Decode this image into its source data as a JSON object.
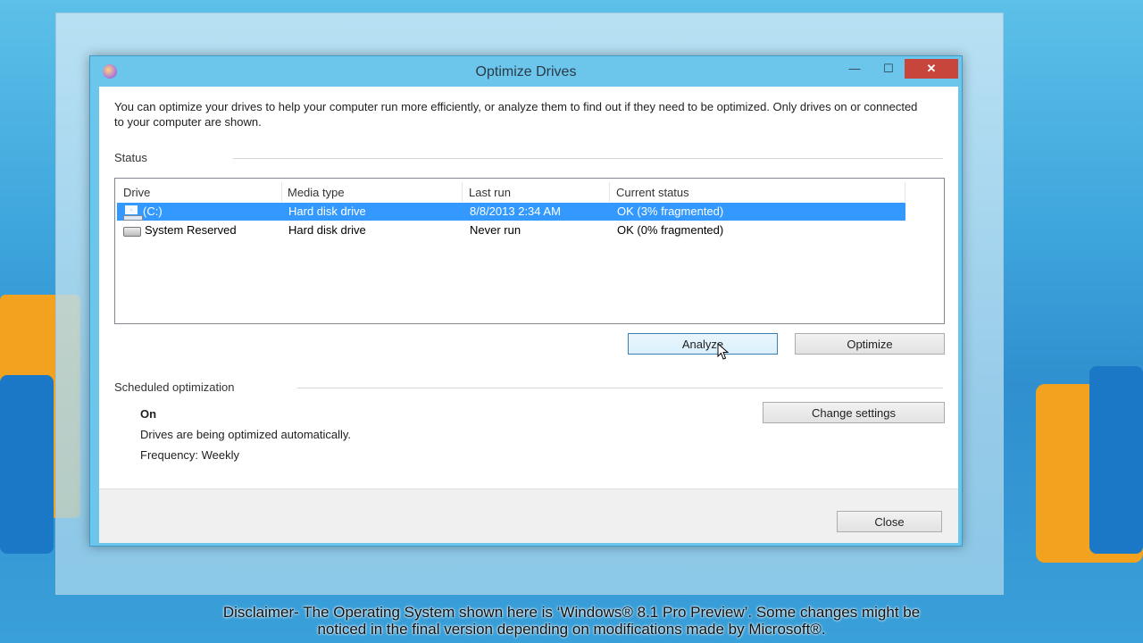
{
  "window": {
    "title": "Optimize Drives",
    "minimize_label": "—",
    "maximize_label": "☐",
    "close_label": "✕"
  },
  "description": "You can optimize your drives to help your computer run more efficiently, or analyze them to find out if they need to be optimized. Only drives on or connected to your computer are shown.",
  "status": {
    "label": "Status",
    "columns": [
      "Drive",
      "Media type",
      "Last run",
      "Current status"
    ],
    "rows": [
      {
        "drive": "(C:)",
        "media": "Hard disk drive",
        "last_run": "8/8/2013 2:34 AM",
        "status": "OK (3% fragmented)",
        "icon": "windows-drive-icon",
        "selected": true
      },
      {
        "drive": "System Reserved",
        "media": "Hard disk drive",
        "last_run": "Never run",
        "status": "OK (0% fragmented)",
        "icon": "drive-icon",
        "selected": false
      }
    ]
  },
  "buttons": {
    "analyze": "Analyze",
    "optimize": "Optimize",
    "change_settings": "Change settings",
    "close": "Close"
  },
  "scheduled": {
    "label": "Scheduled optimization",
    "state": "On",
    "detail": "Drives are being optimized automatically.",
    "frequency": "Frequency: Weekly"
  },
  "disclaimer": {
    "line1": "Disclaimer- The Operating System shown here is ‘Windows® 8.1 Pro Preview’. Some changes might be",
    "line2": "noticed in the final version depending on modifications made by Microsoft®."
  },
  "colors": {
    "selection": "#3399ff",
    "close_button": "#c7453b",
    "frame": "#6cc5ea"
  }
}
